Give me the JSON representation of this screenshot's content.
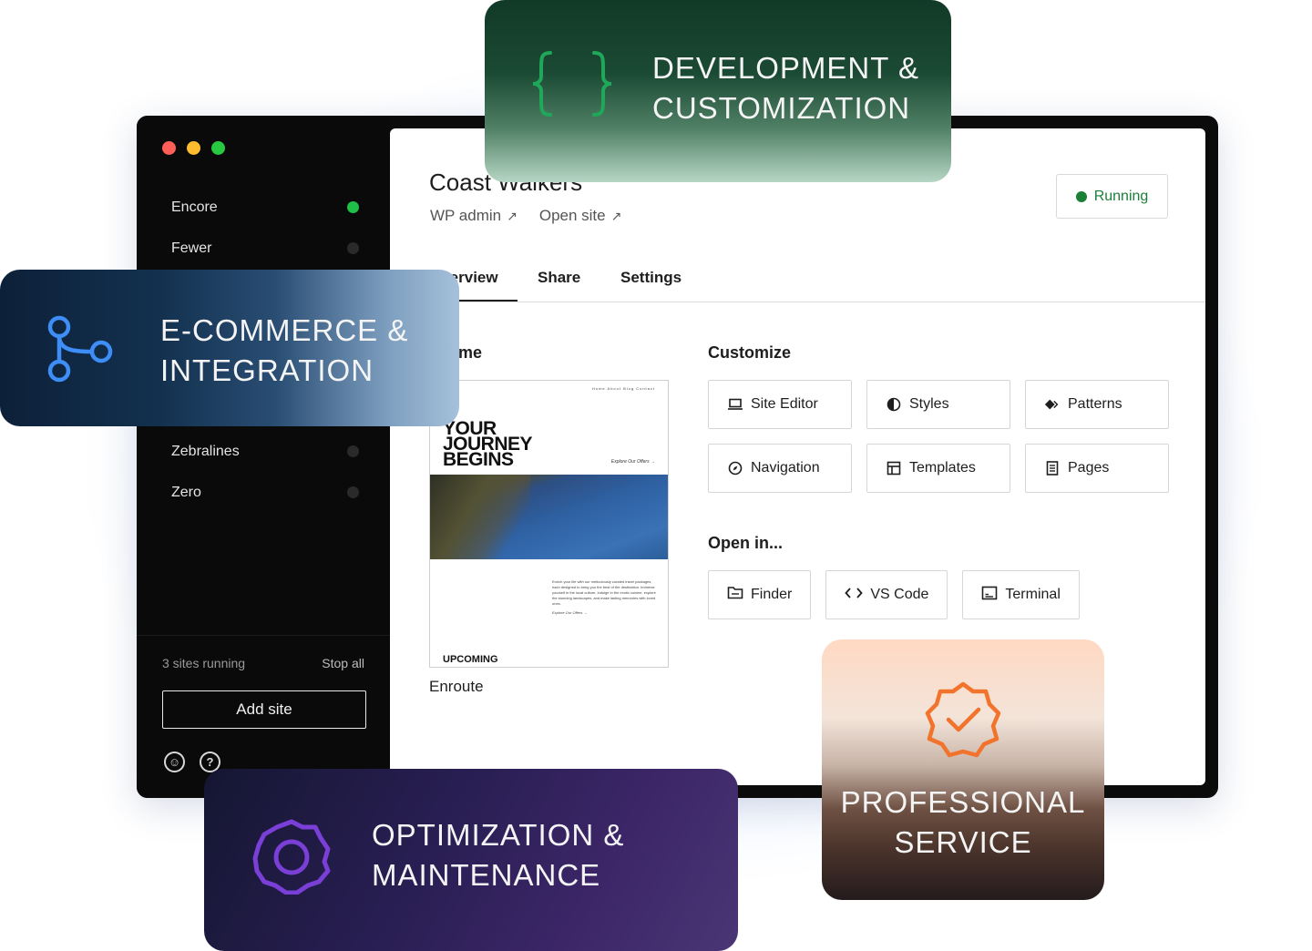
{
  "window": {
    "traffic_colors": [
      "#ff5f57",
      "#febc2e",
      "#28c840"
    ]
  },
  "sidebar": {
    "sites": [
      {
        "name": "Encore",
        "running": true
      },
      {
        "name": "Fewer",
        "running": false
      },
      {
        "name": "Zebralines",
        "running": false
      },
      {
        "name": "Zero",
        "running": false
      }
    ],
    "status_text": "3 sites running",
    "stop_all_label": "Stop all",
    "add_site_label": "Add site",
    "account_icon": "user-circle-icon",
    "help_icon": "help-circle-icon"
  },
  "main": {
    "site_title": "Coast Walkers",
    "wp_admin_label": "WP admin",
    "open_site_label": "Open site",
    "status_label": "Running",
    "status_color": "#1a7f37",
    "tabs": [
      "Overview",
      "Share",
      "Settings"
    ],
    "active_tab": "Overview",
    "theme": {
      "heading": "Theme",
      "name": "Enroute",
      "preview_headline_1": "YOUR",
      "preview_headline_2": "JOURNEY",
      "preview_headline_3": "BEGINS",
      "preview_nav": "Home  About  Blog  Contact",
      "preview_explore": "Explore Our Offers →",
      "preview_explore_2": "Explore Our Offers →",
      "preview_paragraph": "Enrich your life with our meticulously curated travel packages, each designed to bring you the best of the destination. Immerse yourself in the local culture, indulge in the exotic cuisine, explore the stunning landscapes, and make lasting memories with loved ones.",
      "preview_upcoming": "UPCOMING"
    },
    "customize": {
      "heading": "Customize",
      "buttons": [
        {
          "label": "Site Editor",
          "icon": "laptop-icon"
        },
        {
          "label": "Styles",
          "icon": "half-circle-icon"
        },
        {
          "label": "Patterns",
          "icon": "diamond-icon"
        },
        {
          "label": "Navigation",
          "icon": "compass-icon"
        },
        {
          "label": "Templates",
          "icon": "layout-icon"
        },
        {
          "label": "Pages",
          "icon": "page-icon"
        }
      ]
    },
    "open_in": {
      "heading": "Open in...",
      "buttons": [
        {
          "label": "Finder",
          "icon": "folder-icon"
        },
        {
          "label": "VS Code",
          "icon": "code-icon"
        },
        {
          "label": "Terminal",
          "icon": "terminal-icon"
        }
      ]
    }
  },
  "cards": {
    "dev": {
      "line1": "DEVELOPMENT &",
      "line2": "CUSTOMIZATION",
      "icon": "braces-icon",
      "icon_color": "#1fa75a"
    },
    "ecom": {
      "line1": "E-COMMERCE &",
      "line2": "INTEGRATION",
      "icon": "branch-icon",
      "icon_color": "#3d8ef7"
    },
    "opt": {
      "line1": "OPTIMIZATION &",
      "line2": "MAINTENANCE",
      "icon": "gear-icon",
      "icon_color": "#7a3fd6"
    },
    "pro": {
      "line1": "PROFESSIONAL",
      "line2": "SERVICE",
      "icon": "badge-check-icon",
      "icon_color": "#f2742c"
    }
  }
}
